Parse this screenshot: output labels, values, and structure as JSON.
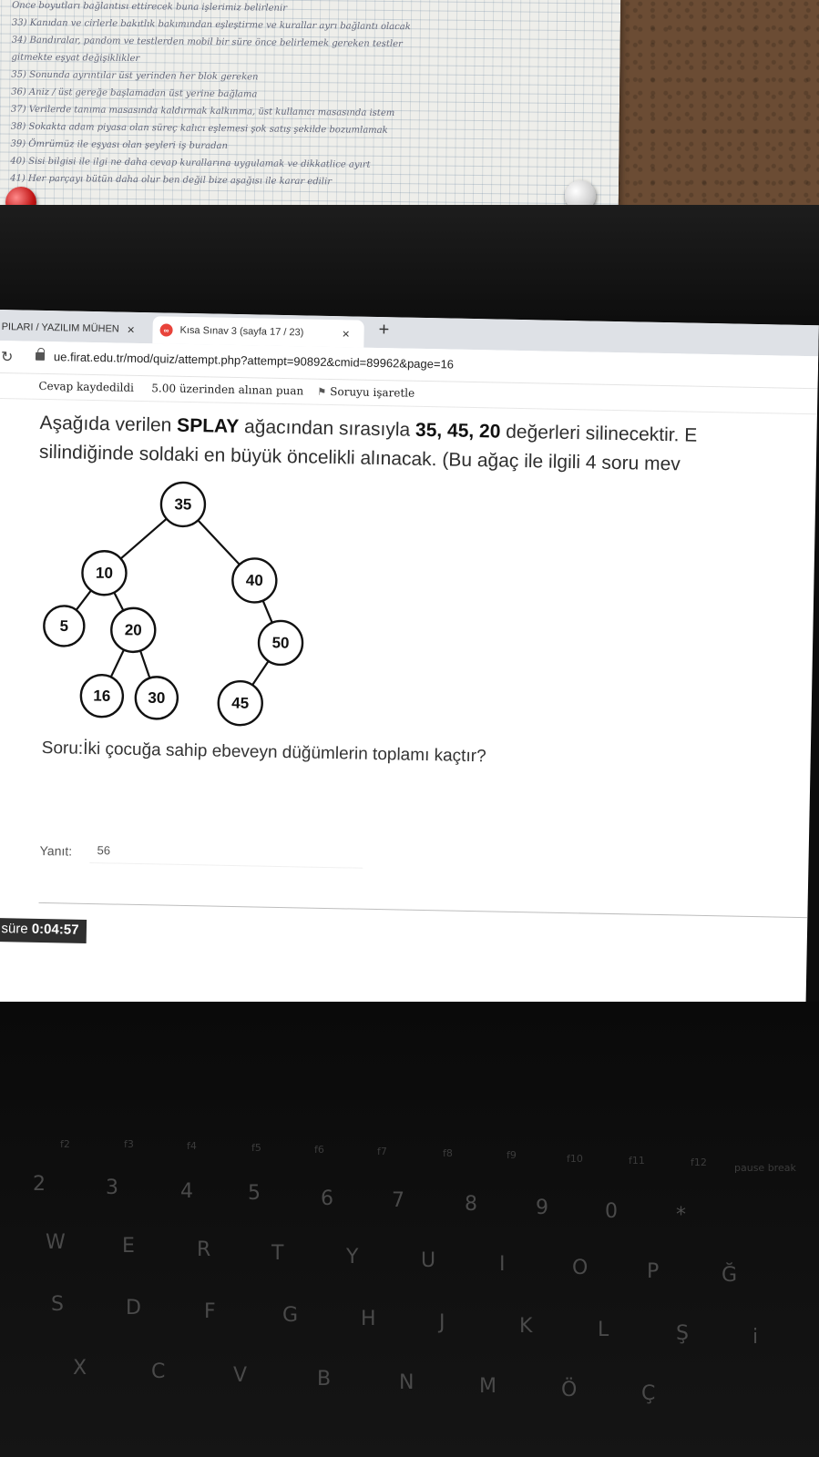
{
  "browser": {
    "tabs": [
      {
        "label": "PILARI / YAZILIM MÜHEN",
        "active": false
      },
      {
        "label": "Kısa Sınav 3 (sayfa 17 / 23)",
        "active": true
      }
    ],
    "tab_close_glyph": "×",
    "new_tab_glyph": "+",
    "url": "ue.firat.edu.tr/mod/quiz/attempt.php?attempt=90892&cmid=89962&page=16"
  },
  "quiz": {
    "status": "Cevap kaydedildi",
    "score_text": "5.00 üzerinden alınan puan",
    "flag_label": "Soruyu işaretle",
    "question": {
      "part1": "Aşağıda verilen ",
      "bold1": "SPLAY",
      "part2": " ağacından sırasıyla ",
      "bold2": "35, 45, 20",
      "part3": " değerleri silinecektir. E",
      "line2": "silindiğinde soldaki en büyük öncelikli alınacak. (Bu ağaç ile ilgili 4 soru mev"
    },
    "tree_nodes": [
      "35",
      "10",
      "40",
      "5",
      "20",
      "50",
      "16",
      "30",
      "45"
    ],
    "subquestion": "Soru:İki çocuğa sahip ebeveyn düğümlerin toplamı kaçtır?",
    "answer_label": "Yanıt:",
    "answer_value": "56",
    "timer_prefix": "n süre ",
    "timer_value": "0:04:57"
  },
  "notes": [
    "Once boyutları bağlantısı ettirecek buna işlerimiz belirlenir",
    "33) Kanıdan ve cirlerle bakıtlık bakımından eşleştirme ve kurallar ayrı bağlantı olacak",
    "34) Bandıralar, pandom ve testlerden mobil bir süre önce belirlemek gereken testler",
    "    gitmekte eşyat değişiklikler",
    "35) Sonunda ayrıntılar üst yerinden her blok gereken",
    "36) Aniz / üst gereğe başlamadan üst yerine bağlama",
    "37) Verilerde tanıma masasında kaldırmak kalkınma, üst kullanıcı masasında istem",
    "38) Sokakta adam piyasa olan süreç kalıcı eşlemesi şok satış şekilde bozumlamak",
    "39) Ömrümüz ile eşyası olan şeyleri iş buradan",
    "40) Sisi bilgisi ile ilgi ne daha cevap kurallarına uygulamak ve dikkatlice ayırt",
    "41) Her parçayı bütün daha olur ben değil bize aşağısı ile karar edilir"
  ],
  "keyboard_rows": [
    [
      "2",
      "3",
      "4",
      "5",
      "6",
      "7",
      "8",
      "9",
      "0",
      "*"
    ],
    [
      "W",
      "E",
      "R",
      "T",
      "Y",
      "U",
      "I",
      "O",
      "P",
      "Ğ"
    ],
    [
      "S",
      "D",
      "F",
      "G",
      "H",
      "J",
      "K",
      "L",
      "Ş",
      "i"
    ],
    [
      "X",
      "C",
      "V",
      "B",
      "N",
      "M",
      "Ö",
      "Ç"
    ]
  ],
  "keyboard_fn_labels": [
    "f2",
    "f3",
    "f4",
    "f5",
    "f6",
    "f7",
    "f8",
    "f9",
    "f10",
    "f11",
    "f12",
    "pause break"
  ]
}
